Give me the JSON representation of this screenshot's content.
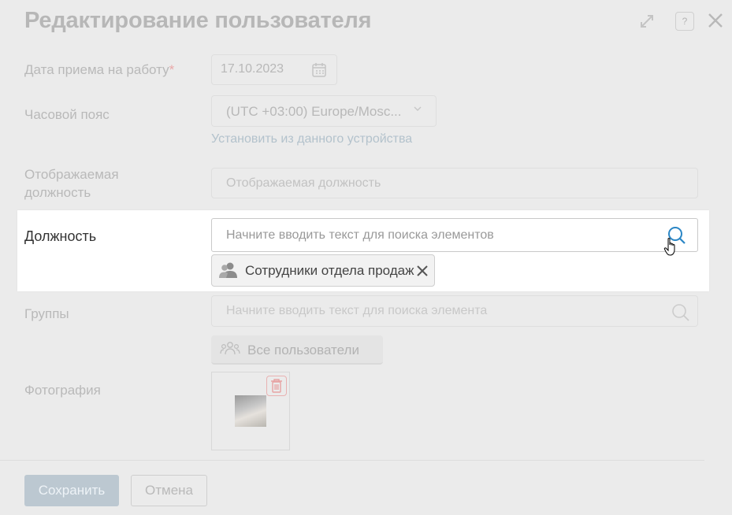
{
  "dialog": {
    "title": "Редактирование пользователя"
  },
  "form": {
    "hire_date": {
      "label": "Дата приема на работу",
      "required_mark": "*",
      "value": "17.10.2023"
    },
    "timezone": {
      "label": "Часовой пояс",
      "value": "(UTC +03:00) Europe/Mosc...",
      "set_from_device": "Установить из данного устройства"
    },
    "display_position": {
      "label": "Отображаемая должность",
      "placeholder": "Отображаемая должность"
    },
    "position": {
      "label": "Должность",
      "placeholder": "Начните вводить текст для поиска элементов",
      "selected": "Сотрудники отдела продаж"
    },
    "groups": {
      "label": "Группы",
      "placeholder": "Начните вводить текст для поиска элемента",
      "selected": "Все пользователи"
    },
    "photo": {
      "label": "Фотография"
    }
  },
  "footer": {
    "save_label": "Сохранить",
    "cancel_label": "Отмена"
  },
  "help_label": "?",
  "colors": {
    "accent": "#1e7fc1",
    "panel_bg": "#ffffff",
    "overlay_bg": "#ebebeb"
  }
}
